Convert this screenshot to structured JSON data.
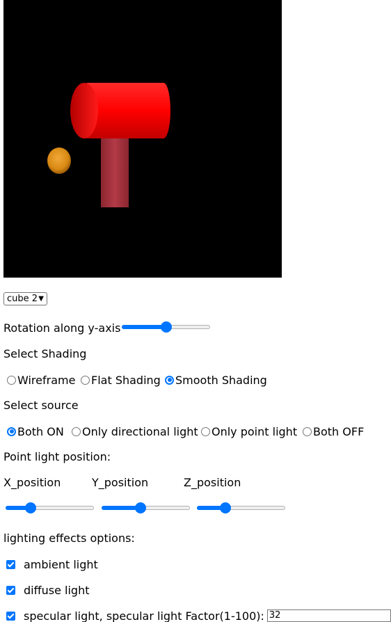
{
  "object_select": {
    "selected": "cube 2"
  },
  "rotation": {
    "label": "Rotation along y-axis",
    "value_pct": 50
  },
  "shading": {
    "heading": "Select Shading",
    "options": [
      {
        "label": "Wireframe",
        "checked": false
      },
      {
        "label": "Flat Shading",
        "checked": false
      },
      {
        "label": "Smooth Shading",
        "checked": true
      }
    ]
  },
  "source": {
    "heading": "Select source",
    "options": [
      {
        "label": "Both ON",
        "checked": true
      },
      {
        "label": "Only directional light",
        "checked": false
      },
      {
        "label": "Only point light",
        "checked": false
      },
      {
        "label": "Both OFF",
        "checked": false
      }
    ]
  },
  "point_light": {
    "heading": "Point light position:",
    "x_label": "X_position",
    "y_label": "Y_position",
    "z_label": "Z_position",
    "x_pct": 25,
    "y_pct": 43,
    "z_pct": 30
  },
  "lighting": {
    "heading": "lighting effects options:",
    "ambient_label": "ambient light",
    "diffuse_label": "diffuse light",
    "specular_label": "specular light, specular light Factor(1-100):",
    "specular_value": "32"
  },
  "colors": {
    "accent": "#0075ff",
    "canvas_bg": "#000000",
    "hammer_head": "#ff0000",
    "hammer_handle": "#a8333f",
    "sphere": "#e8961c"
  }
}
